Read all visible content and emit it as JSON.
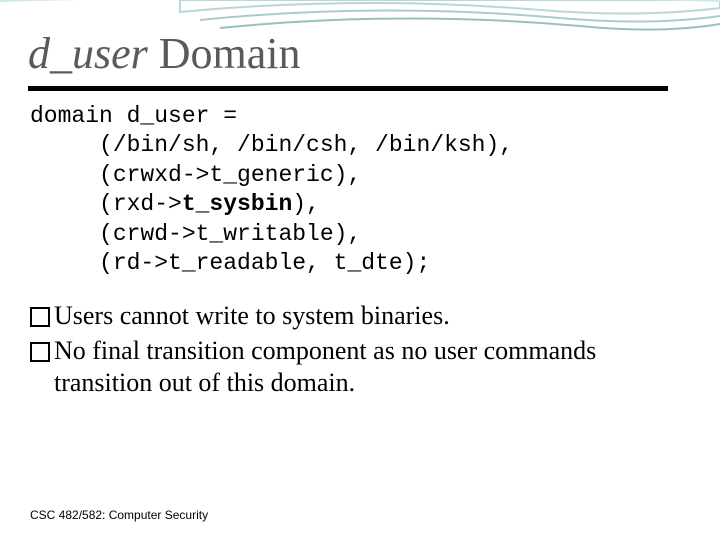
{
  "title": {
    "italic_part": "d_user",
    "plain_part": " Domain"
  },
  "code": {
    "line1": "domain d_user =",
    "line2": "     (/bin/sh, /bin/csh, /bin/ksh),",
    "line3": "     (crwxd->t_generic),",
    "line4_a": "     (rxd->",
    "line4_bold": "t_sysbin",
    "line4_b": "),",
    "line5": "     (crwd->t_writable),",
    "line6": "     (rd->t_readable, t_dte);"
  },
  "bullets": [
    "Users cannot write to system binaries.",
    "No final transition component as no user commands transition out of this domain."
  ],
  "footer": "CSC 482/582: Computer Security"
}
